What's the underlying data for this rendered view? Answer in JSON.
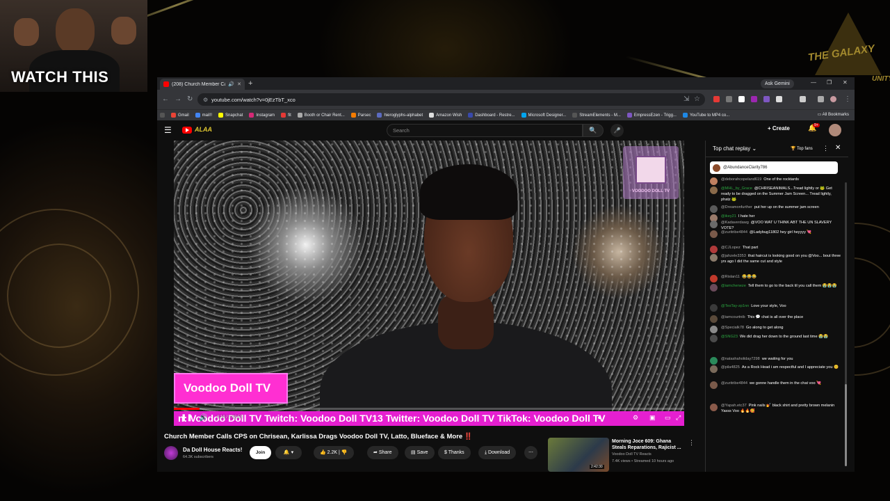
{
  "overlay": {
    "cam_label": "WATCH THIS",
    "logo_text": "THE GALAXY",
    "logo_sub": "UNITY"
  },
  "browser": {
    "tab_title": "(208) Church Member Call",
    "ask_gemini": "Ask Gemini",
    "url": "youtube.com/watch?v=0jEzTbT_xco",
    "bookmarks": [
      "Gmail",
      "mail!!",
      "Snapchat",
      "Instagram",
      "fit",
      "Booth or Chair Rent...",
      "Parsec",
      "hieroglyphs-alphabet",
      "Amazon Wish",
      "Dashboard - Restre...",
      "Microsoft Designer...",
      "StreamElements - M...",
      "EmpressEzen - Trigg...",
      "YouTube to MP4 co..."
    ],
    "all_bookmarks": "All Bookmarks"
  },
  "youtube": {
    "search_placeholder": "Search",
    "create_label": "Create",
    "notif_count": "9+"
  },
  "video": {
    "lower_third": "Voodoo Doll TV",
    "ticker": "n: Voodoo Doll TV Twitch: Voodoo Doll TV13 Twitter: Voodoo Doll TV TikTok: Voodoo Doll TV",
    "time": "8:19 / 2:48:55",
    "progress": 0.05,
    "logo_text": "VOODOO DOLL TV"
  },
  "meta": {
    "title": "Church Member Calls CPS on Chrisean, Karlissa Drags Voodoo Doll TV, Latto, Blueface & More ‼️",
    "channel": "Da Doll House Reacts!",
    "subscribers": "64.3K subscribers",
    "join": "Join",
    "likes": "2.2K",
    "share": "Share",
    "save": "Save",
    "thanks": "Thanks",
    "download": "Download"
  },
  "related": {
    "title": "Morning Joce 609: Ghana Steals Reparations, Rajicist ...",
    "channel": "Voodoo Doll TV Reacts",
    "meta": "7.4K views • Streamed 10 hours ago",
    "duration": "2:42:30"
  },
  "chat": {
    "title": "Top chat replay",
    "top_fans": "Top fans",
    "pinned": "@AbundanceClarity786",
    "messages": [
      {
        "author": "@deborahcopeland619",
        "text": "One of the rocktards",
        "color": "#c08060"
      },
      {
        "author": "@MHL_by_Grace",
        "text": "@CHRISEANIMALS...Tread lightly or 🐸 Get ready to be dragged on the Summer Jam Screen... Tread lightly, phatz 🐸",
        "color": "#8a6a4a",
        "member": true
      },
      {
        "author": "@Dreamonfurther",
        "text": "put her up on the summer jam screen",
        "color": "#5a5a5a"
      },
      {
        "author": "@ikey21",
        "text": "I hate her",
        "color": "#9a7a6a",
        "member": true
      },
      {
        "author": "@Kadaverdawg",
        "text": "@VOO WAT U THINK ABT THE UN SLAVERY VOTE?",
        "color": "#6a6a6a"
      },
      {
        "author": "@zuritribe4844",
        "text": "@Ladybug11802 hey girl heyyyy 💘",
        "color": "#7a5a4a"
      },
      {
        "author": "@CJLopez",
        "text": "That part",
        "color": "#b03a3a"
      },
      {
        "author": "@jahzele3353",
        "text": "that haircut is looking good on you @Voo... bout three yrs ago I did the same cut and style",
        "color": "#8a7a6a"
      },
      {
        "author": "@Rislan11",
        "text": "😂😂😂",
        "color": "#c0392b"
      },
      {
        "author": "@iamcheneze",
        "text": "Tell them to go to the back til you call them 😭😭😭",
        "color": "#6a4a5a",
        "member": true
      },
      {
        "author": "@TesTay-zp1nn",
        "text": "Love your style, Voo",
        "color": "#3a3a3a",
        "member": true
      },
      {
        "author": "@iamcourtnib",
        "text": "This 💬 chat is all over the place",
        "color": "#5a4a3a"
      },
      {
        "author": "@Specialk78",
        "text": "Go along to get along",
        "color": "#8a8a8a"
      },
      {
        "author": "@SNG23",
        "text": "We did drag her down to the ground last time 😭😭",
        "color": "#4a4a4a",
        "member": true
      },
      {
        "author": "@natashaholiday7298",
        "text": "we waiting for you",
        "color": "#2a8a5a"
      },
      {
        "author": "@pila4825",
        "text": "As a Rock Head i am respectful and I appreciate you 😊",
        "color": "#7a6a5a"
      },
      {
        "author": "@zuritribe4844",
        "text": "we gonne handle them in the chat voo 💘",
        "color": "#7a5a4a"
      },
      {
        "author": "@Yapah.etc37",
        "text": "Pink nails 💅 black shirt and pretty brown melanin Yasss Voo 🔥🔥🥰",
        "color": "#8a5a4a"
      }
    ]
  }
}
